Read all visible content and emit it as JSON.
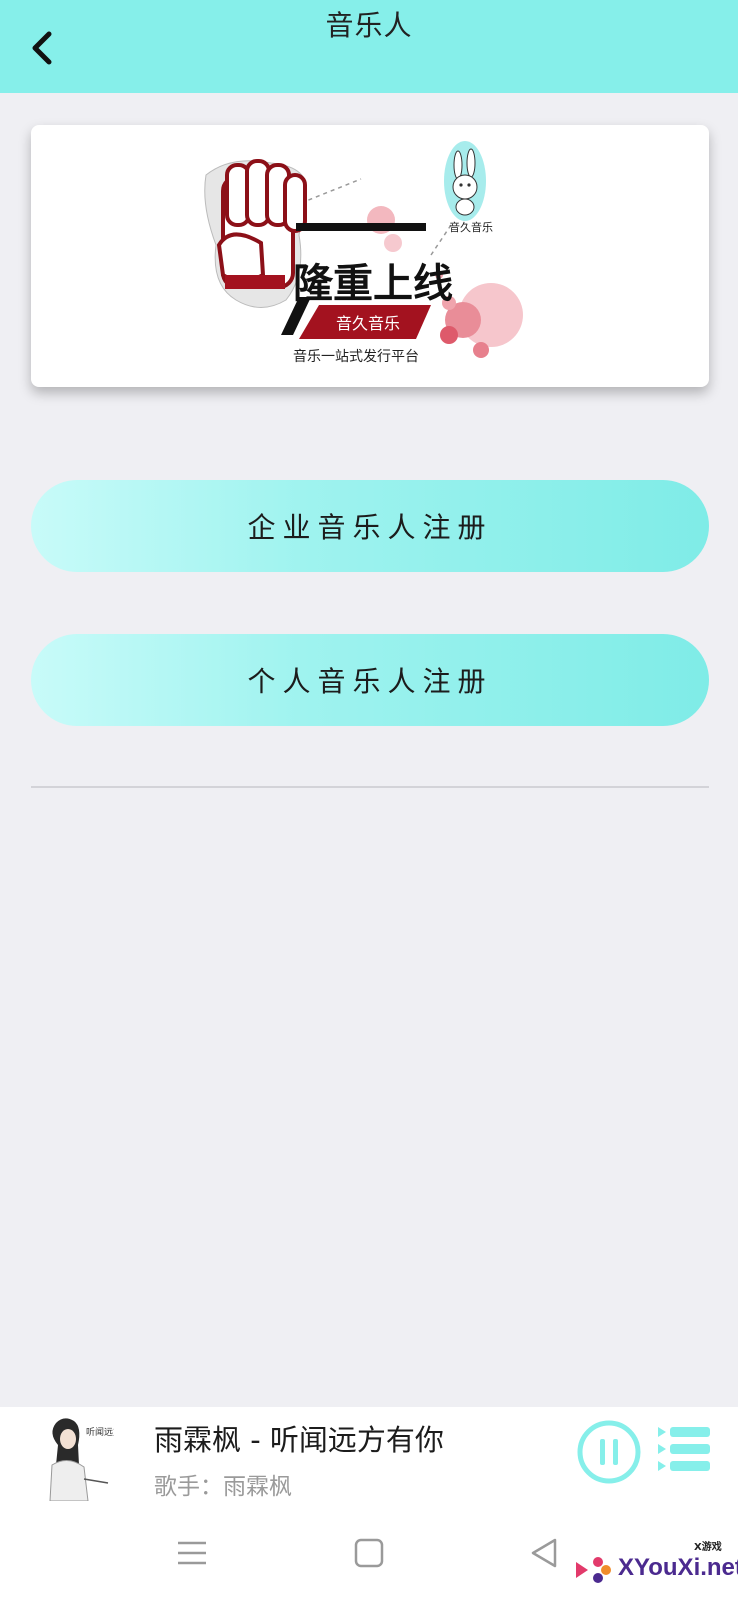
{
  "header": {
    "title": "音乐人",
    "back_icon": "chevron-left-icon"
  },
  "banner": {
    "headline": "隆重上线",
    "brand_tag": "音久音乐",
    "slogan": "音乐一站式发行平台",
    "logo_caption": "音久音乐"
  },
  "actions": {
    "enterprise_register": "企业音乐人注册",
    "personal_register": "个人音乐人注册"
  },
  "player": {
    "song_title": "雨霖枫 - 听闻远方有你",
    "artist_prefix": "歌手：",
    "artist_name": "雨霖枫",
    "cover_caption": "听闻远方",
    "play_icon": "pause-circle-icon",
    "playlist_icon": "playlist-icon"
  },
  "navbar": {
    "items": [
      "menu-icon",
      "home-square-icon",
      "back-triangle-icon"
    ]
  },
  "watermark": {
    "small_text": "X游戏",
    "site": "XYouXi.net"
  },
  "colors": {
    "accent": "#86efea",
    "banner_red": "#a3121f",
    "background": "#efeff3"
  }
}
